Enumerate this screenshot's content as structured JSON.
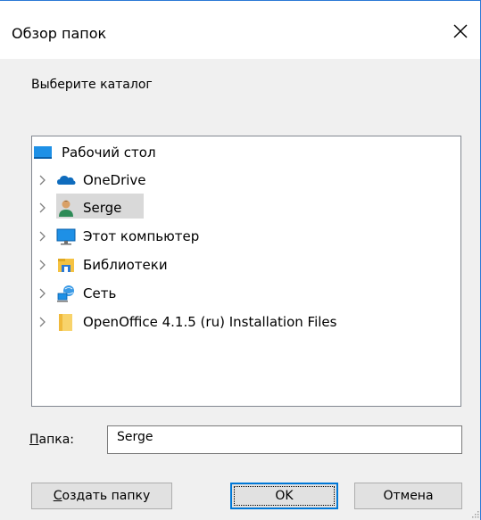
{
  "window": {
    "title": "Обзор папок",
    "close_icon": "close-icon"
  },
  "instruction": "Выберите каталог",
  "tree": {
    "root": {
      "label": "Рабочий стол",
      "icon": "desktop-icon"
    },
    "items": [
      {
        "label": "OneDrive",
        "icon": "onedrive-cloud-icon",
        "expandable": true
      },
      {
        "label": "Serge",
        "icon": "user-icon",
        "expandable": true,
        "selected": true
      },
      {
        "label": "Этот компьютер",
        "icon": "computer-icon",
        "expandable": true
      },
      {
        "label": "Библиотеки",
        "icon": "libraries-icon",
        "expandable": true
      },
      {
        "label": "Сеть",
        "icon": "network-icon",
        "expandable": true
      },
      {
        "label": "OpenOffice 4.1.5 (ru) Installation Files",
        "icon": "folder-icon",
        "expandable": true
      }
    ]
  },
  "folder": {
    "label_underlined": "П",
    "label_rest": "апка:",
    "value": "Serge"
  },
  "buttons": {
    "create_underlined": "С",
    "create_rest": "оздать папку",
    "ok": "OK",
    "cancel": "Отмена"
  },
  "colors": {
    "accent": "#0078d7",
    "selection": "#d9d9d9",
    "dialog_bg": "#f0f0f0"
  }
}
